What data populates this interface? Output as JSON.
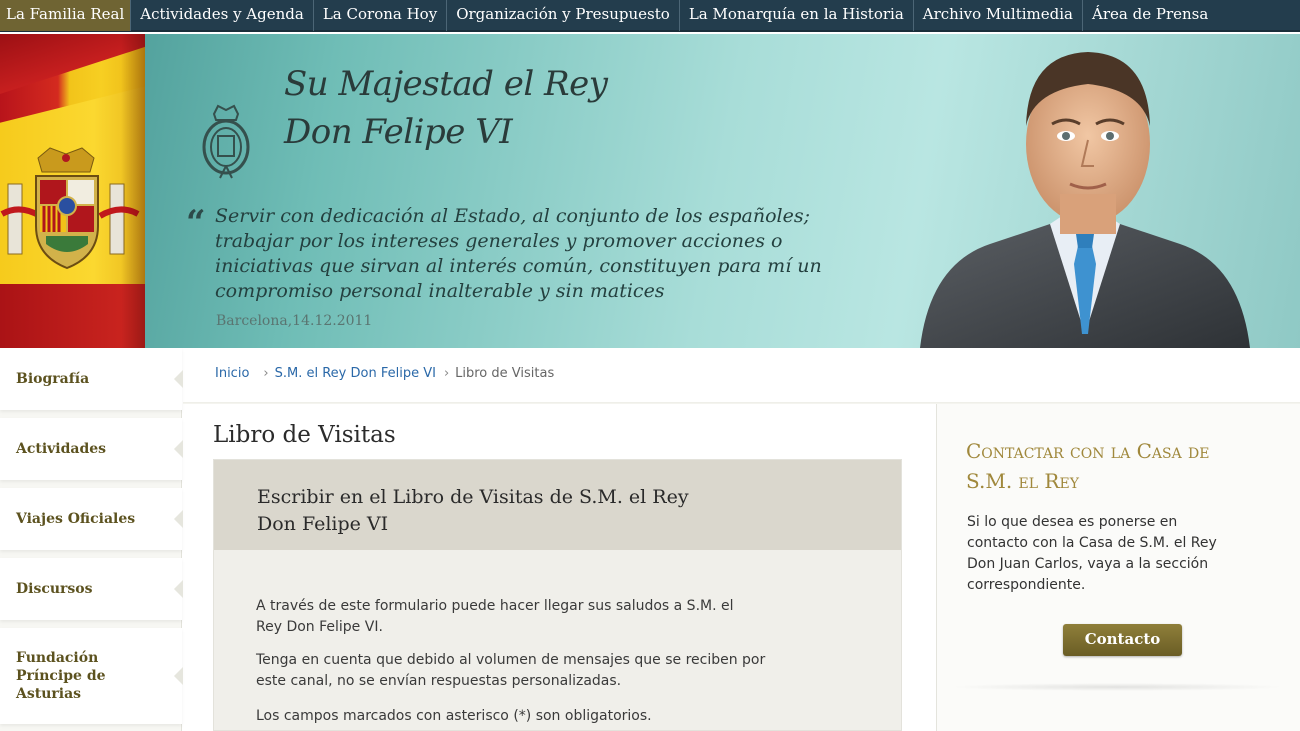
{
  "topnav": {
    "items": [
      "La Familia Real",
      "Actividades y Agenda",
      "La Corona Hoy",
      "Organización y Presupuesto",
      "La Monarquía en la Historia",
      "Archivo Multimedia",
      "Área de Prensa"
    ]
  },
  "banner": {
    "title_line1": "Su Majestad el Rey",
    "title_line2": "Don Felipe VI",
    "quote_mark": "“",
    "quote_lines": [
      "Servir con dedicación al Estado, al conjunto de los españoles;",
      "trabajar por los intereses generales y promover acciones o",
      "iniciativas que sirvan al interés común, constituyen para mí un",
      "compromiso personal inalterable y sin matices"
    ],
    "quote_place": "Barcelona,14.12.2011"
  },
  "sidebar": {
    "items": [
      "Biografía",
      "Actividades",
      "Viajes Oficiales",
      "Discursos"
    ],
    "fundacion_lines": [
      "Fundación",
      "Príncipe de",
      "Asturias"
    ]
  },
  "breadcrumb": {
    "home": "Inicio",
    "sep": "›",
    "parent": "S.M. el Rey Don Felipe VI",
    "current": "Libro de Visitas"
  },
  "main": {
    "title": "Libro de Visitas",
    "card_title_line1": "Escribir en el Libro de Visitas de S.M. el Rey",
    "card_title_line2": "Don Felipe VI",
    "para1_line1": "A través de este formulario puede hacer llegar sus saludos a S.M. el",
    "para1_line2": "Rey Don Felipe VI.",
    "para2_line1": "Tenga en cuenta que debido al volumen de mensajes que se reciben por",
    "para2_line2": "este canal, no se envían respuestas personalizadas.",
    "para3": "Los campos marcados con asterisco (*) son obligatorios."
  },
  "contact": {
    "title_line1": "Contactar con la Casa de",
    "title_line2": "S.M. el Rey",
    "text_lines": [
      "Si lo que desea es ponerse en",
      "contacto con la Casa de S.M. el Rey",
      "Don Juan Carlos, vaya a la sección",
      "correspondiente."
    ],
    "button": "Contacto"
  },
  "colors": {
    "nav_bg": "#233d4d",
    "nav_active": "#6f6433",
    "accent_gold": "#a0883c",
    "link_blue": "#2a68a8"
  }
}
